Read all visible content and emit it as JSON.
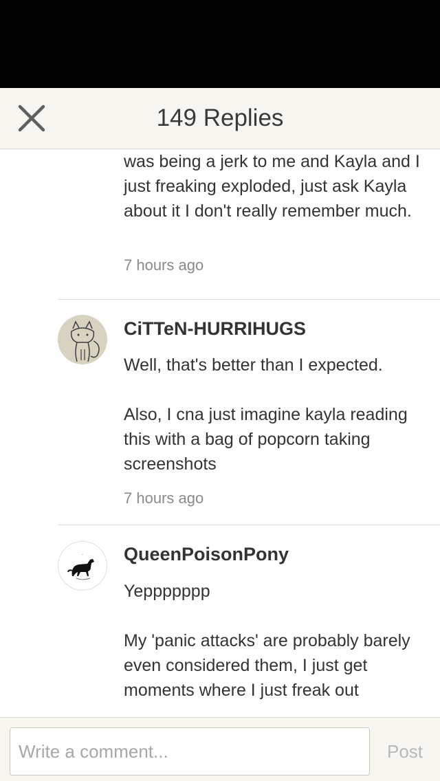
{
  "header": {
    "title": "149 Replies",
    "close_icon": "close-icon"
  },
  "comments": [
    {
      "text": "was being a jerk to me and Kayla and I just freaking exploded, just ask Kayla about it I don't really remember much.",
      "time": "7 hours ago"
    },
    {
      "author": "CiTTeN-HURRIHUGS",
      "avatar_icon": "cat-sketch-avatar",
      "text": "Well, that's better than I expected.\n\nAlso, I cna just imagine kayla reading this with a bag of popcorn taking screenshots",
      "time": "7 hours ago"
    },
    {
      "author": "QueenPoisonPony",
      "avatar_icon": "horse-silhouette-avatar",
      "text": "Yeppppppp\n\nMy 'panic attacks' are probably barely even considered them, I just get moments where I just freak out"
    }
  ],
  "composer": {
    "placeholder": "Write a comment...",
    "post_label": "Post"
  },
  "colors": {
    "header_bg": "#f7f6f1",
    "text": "#333333",
    "muted": "#8a8a8a",
    "post_disabled": "#b9b9b9"
  }
}
